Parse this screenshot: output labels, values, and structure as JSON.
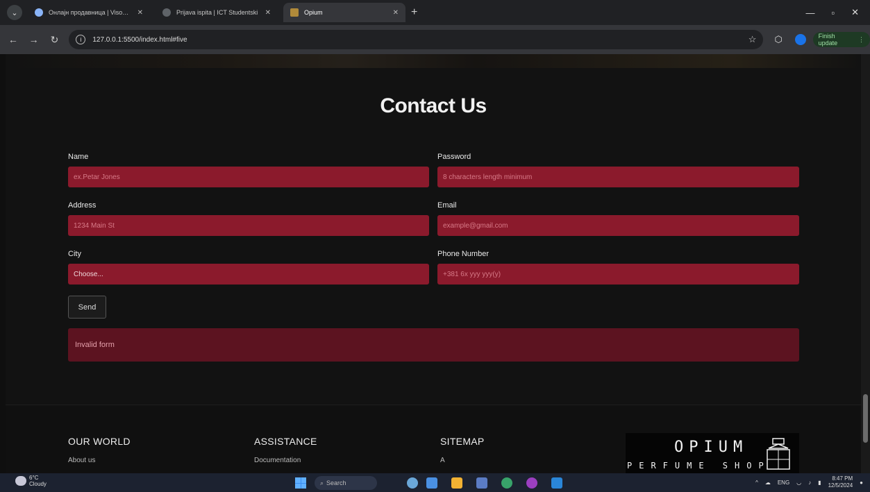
{
  "browser": {
    "tabs": [
      {
        "title": "Онлајн продавница | Visoka ICT",
        "active": false
      },
      {
        "title": "Prijava ispita | ICT Studentski",
        "active": false
      },
      {
        "title": "Opium",
        "active": true
      }
    ],
    "url": "127.0.0.1:5500/index.html#five",
    "finish_update": "Finish update"
  },
  "page": {
    "title": "Contact Us",
    "form": {
      "name": {
        "label": "Name",
        "placeholder": "ex.Petar Jones"
      },
      "password": {
        "label": "Password",
        "placeholder": "8 characters length minimum"
      },
      "address": {
        "label": "Address",
        "placeholder": "1234 Main St"
      },
      "email": {
        "label": "Email",
        "placeholder": "example@gmail.com"
      },
      "city": {
        "label": "City",
        "value": "Choose..."
      },
      "phone": {
        "label": "Phone Number",
        "placeholder": "+381 6x yyy yyy(y)"
      },
      "send_label": "Send",
      "alert": "Invalid form"
    },
    "footer": {
      "columns": [
        {
          "heading": "OUR WORLD",
          "link": "About us"
        },
        {
          "heading": "ASSISTANCE",
          "link": "Documentation"
        },
        {
          "heading": "SITEMAP",
          "link": "A"
        }
      ],
      "logo_main": "OPIUM",
      "logo_sub": "PERFUME SHOP"
    }
  },
  "taskbar": {
    "weather_temp": "6°C",
    "weather_desc": "Cloudy",
    "search": "Search",
    "lang": "ENG",
    "time": "8:47 PM",
    "date": "12/5/2024"
  }
}
